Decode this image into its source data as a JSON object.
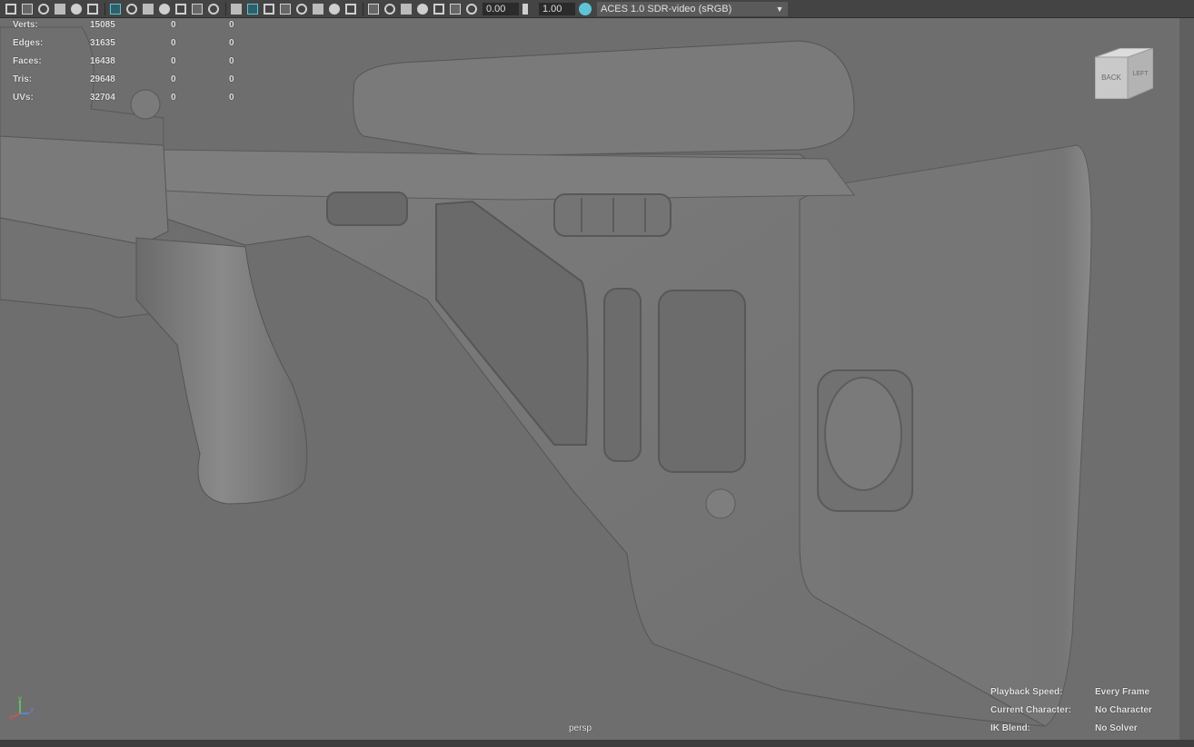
{
  "toolbar": {
    "field_a": "0.00",
    "field_b": "1.00",
    "color_mode_label": "ACES 1.0 SDR-video (sRGB)",
    "icons": [
      "camera-icon",
      "camera-attributes-icon",
      "bookmark-icon",
      "image-plane-icon",
      "2d-pan-zoom-icon",
      "grease-pencil-icon",
      "grid-icon",
      "film-gate-icon",
      "resolution-gate-icon",
      "gate-mask-icon",
      "field-chart-icon",
      "safe-action-icon",
      "safe-title-icon",
      "wireframe-icon",
      "smooth-shade-icon",
      "default-material-icon",
      "textured-icon",
      "use-all-lights-icon",
      "shadows-icon",
      "screen-space-ao-icon",
      "motion-blur-icon",
      "anti-aliasing-icon",
      "depth-of-field-icon",
      "isolate-select-icon",
      "xray-icon",
      "xray-joints-icon",
      "xray-components-icon",
      "exposure-icon",
      "gamma-icon",
      "color-management-icon"
    ]
  },
  "hud_stats": [
    {
      "label": "Verts:",
      "value": "15085",
      "a": "0",
      "b": "0"
    },
    {
      "label": "Edges:",
      "value": "31635",
      "a": "0",
      "b": "0"
    },
    {
      "label": "Faces:",
      "value": "16438",
      "a": "0",
      "b": "0"
    },
    {
      "label": "Tris:",
      "value": "29648",
      "a": "0",
      "b": "0"
    },
    {
      "label": "UVs:",
      "value": "32704",
      "a": "0",
      "b": "0"
    }
  ],
  "hud_info": [
    {
      "label": "Playback Speed:",
      "value": "Every Frame"
    },
    {
      "label": "Current Character:",
      "value": "No Character"
    },
    {
      "label": "IK Blend:",
      "value": "No Solver"
    }
  ],
  "camera_name": "persp",
  "viewcube": {
    "back": "BACK",
    "left": "LEFT"
  },
  "axis": {
    "y": "y",
    "x": "x",
    "z": "z"
  },
  "colors": {
    "accent": "#5fc3d6",
    "viewport": "#6e6e6e",
    "toolbar": "#444444"
  }
}
